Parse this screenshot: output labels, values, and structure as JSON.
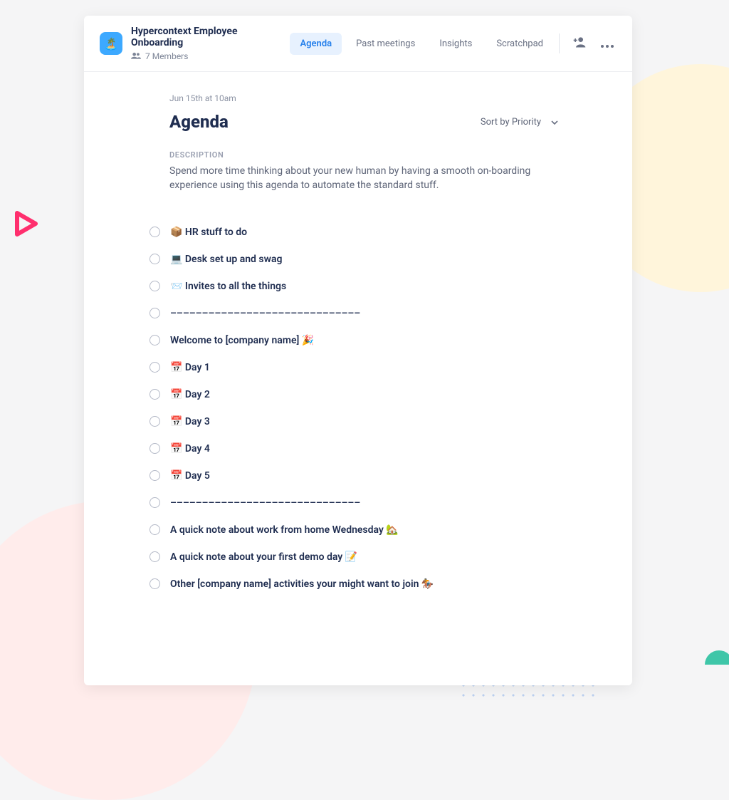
{
  "header": {
    "app_icon_emoji": "🏝️",
    "title": "Hypercontext Employee Onboarding",
    "members_text": "7 Members",
    "tabs": [
      {
        "label": "Agenda",
        "active": true
      },
      {
        "label": "Past meetings",
        "active": false
      },
      {
        "label": "Insights",
        "active": false
      },
      {
        "label": "Scratchpad",
        "active": false
      }
    ]
  },
  "meta": {
    "datetime": "Jun 15th at 10am"
  },
  "agenda": {
    "heading": "Agenda",
    "sort_label": "Sort by Priority",
    "description_label": "DESCRIPTION",
    "description": "Spend more time thinking about your new human by having a smooth on-boarding experience using this agenda to automate the standard stuff."
  },
  "items": [
    {
      "label": "📦 HR stuff to do"
    },
    {
      "label": "💻 Desk set up and swag"
    },
    {
      "label": "📨 Invites to all the things"
    },
    {
      "label": "––––––––––––––––––––––––––––––"
    },
    {
      "label": "Welcome to [company name] 🎉"
    },
    {
      "label": "📅 Day 1"
    },
    {
      "label": "📅 Day 2"
    },
    {
      "label": "📅 Day 3"
    },
    {
      "label": "📅 Day 4"
    },
    {
      "label": "📅 Day 5"
    },
    {
      "label": "––––––––––––––––––––––––––––––"
    },
    {
      "label": "A quick note about work from home Wednesday 🏡"
    },
    {
      "label": "A quick note about your first demo day 📝"
    },
    {
      "label": "Other [company name] activities your might want to join 🏇"
    }
  ]
}
